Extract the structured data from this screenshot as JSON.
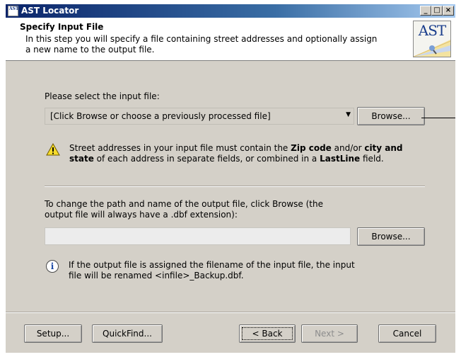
{
  "window": {
    "title": "AST Locator",
    "app_icon_text": "AST",
    "controls": {
      "minimize": "_",
      "maximize": "□",
      "close": "×"
    }
  },
  "header": {
    "title": "Specify Input File",
    "description": "In this step you will specify a file containing street addresses and optionally assign a new name to the output file.",
    "logo_text": "AST"
  },
  "input": {
    "label": "Please select the input file:",
    "combo_value": "[Click Browse or choose a previously processed file]",
    "browse_label": "Browse..."
  },
  "warning": {
    "part1": "Street addresses in your input file must contain the ",
    "bold1": "Zip code",
    "part2": " and/or ",
    "bold2": "city and state",
    "part3": " of each address in separate fields, or combined in a ",
    "bold3": "LastLine",
    "part4": " field."
  },
  "output": {
    "label": "To change the path and name of the output file, click Browse (the output file will always have a .dbf extension):",
    "value": "",
    "browse_label": "Browse..."
  },
  "info": {
    "icon_glyph": "i",
    "text": "If the output file is assigned the filename of the input file, the input file will be renamed <infile>_Backup.dbf."
  },
  "footer": {
    "setup_label": "Setup...",
    "quickfind_label": "QuickFind...",
    "back_label": "< Back",
    "next_label": "Next >",
    "cancel_label": "Cancel"
  }
}
